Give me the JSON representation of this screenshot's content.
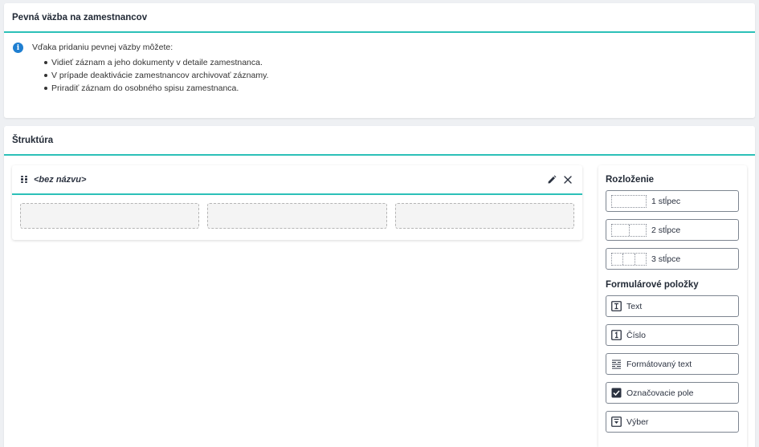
{
  "card1": {
    "title": "Pevná väzba na zamestnancov",
    "info_text": "Vďaka pridaniu pevnej väzby môžete:",
    "bullets": [
      "Vidieť záznam a jeho dokumenty v detaile zamestnanca.",
      "V prípade deaktivácie zamestnancov archivovať záznamy.",
      "Priradiť záznam do osobného spisu zamestnanca."
    ]
  },
  "card2": {
    "title": "Štruktúra",
    "section": {
      "title": "<bez názvu>",
      "columns": 3
    },
    "sidebar": {
      "layout_title": "Rozloženie",
      "layouts": [
        {
          "label": "1 stĺpec",
          "cols": 1
        },
        {
          "label": "2 stĺpce",
          "cols": 2
        },
        {
          "label": "3 stĺpce",
          "cols": 3
        }
      ],
      "form_title": "Formulárové položky",
      "items": [
        {
          "label": "Text",
          "icon": "text-field-icon"
        },
        {
          "label": "Číslo",
          "icon": "number-field-icon"
        },
        {
          "label": "Formátovaný text",
          "icon": "rich-text-icon"
        },
        {
          "label": "Označovacie pole",
          "icon": "checkbox-icon"
        },
        {
          "label": "Výber",
          "icon": "select-icon"
        }
      ]
    }
  },
  "colors": {
    "accent": "#2cc0b8",
    "info": "#1f7fd1",
    "text": "#2b3240"
  }
}
